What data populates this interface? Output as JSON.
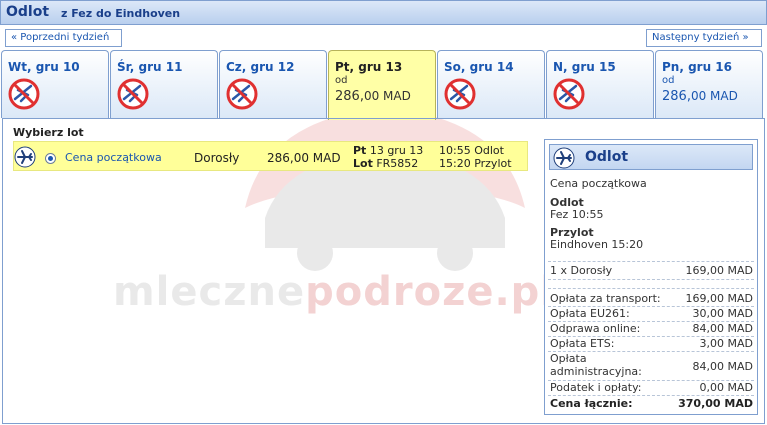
{
  "header": {
    "title": "Odlot",
    "route": "z Fez do Eindhoven"
  },
  "nav": {
    "prev_label": "« Poprzedni tydzień",
    "next_label": "Następny tydzień »"
  },
  "tabs": [
    {
      "label": "Wt, gru 10",
      "available": false
    },
    {
      "label": "Śr, gru 11",
      "available": false
    },
    {
      "label": "Cz, gru 12",
      "available": false
    },
    {
      "label": "Pt, gru 13",
      "available": true,
      "selected": true,
      "from": "od",
      "price_int": "286,",
      "price_dec": "00 MAD"
    },
    {
      "label": "So, gru 14",
      "available": false
    },
    {
      "label": "N, gru 15",
      "available": false
    },
    {
      "label": "Pn, gru 16",
      "available": true,
      "from": "od",
      "price_int": "286,",
      "price_dec": "00 MAD"
    }
  ],
  "flights": {
    "heading": "Wybierz lot",
    "row": {
      "fare": "Cena początkowa",
      "passenger": "Dorosły",
      "amount": "286,00 MAD",
      "day_label": "Pt",
      "date": "13 gru 13",
      "flight_label": "Lot",
      "flight_no": "FR5852",
      "dep": "10:55 Odlot",
      "arr": "15:20 Przylot"
    }
  },
  "summary": {
    "title": "Odlot",
    "fare": "Cena początkowa",
    "dep_label": "Odlot",
    "dep_value": "Fez 10:55",
    "arr_label": "Przylot",
    "arr_value": "Eindhoven 15:20",
    "items": [
      {
        "k": "1 x Dorosły",
        "v": "169,00 MAD"
      },
      {
        "k": "Opłata za transport:",
        "v": "169,00 MAD"
      },
      {
        "k": "Opłata EU261:",
        "v": "30,00 MAD"
      },
      {
        "k": "Odprawa online:",
        "v": "84,00 MAD"
      },
      {
        "k": "Opłata ETS:",
        "v": "3,00 MAD"
      },
      {
        "k1": "Opłata",
        "k2": "administracyjna:",
        "v": "84,00 MAD"
      },
      {
        "k": "Podatek i opłaty:",
        "v": "0,00 MAD"
      },
      {
        "k": "Cena łącznie:",
        "v": "370,00 MAD"
      }
    ]
  },
  "watermark": {
    "part1": "mleczne",
    "part2": "podroze.pl"
  },
  "colors": {
    "accent": "#1a56b0",
    "header_bg": "#c3d6f1",
    "selected_bg": "#ffffa6",
    "row_bg": "#ffff99"
  },
  "icons": {
    "unavailable": "no-flight-icon",
    "plane": "plane-icon"
  }
}
